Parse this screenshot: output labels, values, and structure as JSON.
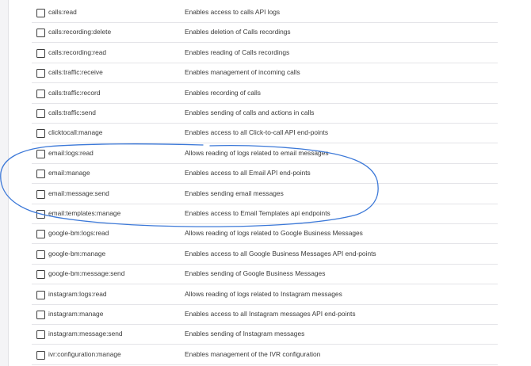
{
  "permissions": [
    {
      "scope": "calls:read",
      "description": "Enables access to calls API logs",
      "checked": false
    },
    {
      "scope": "calls:recording:delete",
      "description": "Enables deletion of Calls recordings",
      "checked": false
    },
    {
      "scope": "calls:recording:read",
      "description": "Enables reading of Calls recordings",
      "checked": false
    },
    {
      "scope": "calls:traffic:receive",
      "description": "Enables management of incoming calls",
      "checked": false
    },
    {
      "scope": "calls:traffic:record",
      "description": "Enables recording of calls",
      "checked": false
    },
    {
      "scope": "calls:traffic:send",
      "description": "Enables sending of calls and actions in calls",
      "checked": false
    },
    {
      "scope": "clicktocall:manage",
      "description": "Enables access to all Click-to-call API end-points",
      "checked": false
    },
    {
      "scope": "email:logs:read",
      "description": "Allows reading of logs related to email messages",
      "checked": false
    },
    {
      "scope": "email:manage",
      "description": "Enables access to all Email API end-points",
      "checked": false
    },
    {
      "scope": "email:message:send",
      "description": "Enables sending email messages",
      "checked": false
    },
    {
      "scope": "email:templates:manage",
      "description": "Enables access to Email Templates api endpoints",
      "checked": false
    },
    {
      "scope": "google-bm:logs:read",
      "description": "Allows reading of logs related to Google Business Messages",
      "checked": false
    },
    {
      "scope": "google-bm:manage",
      "description": "Enables access to all Google Business Messages API end-points",
      "checked": false
    },
    {
      "scope": "google-bm:message:send",
      "description": "Enables sending of Google Business Messages",
      "checked": false
    },
    {
      "scope": "instagram:logs:read",
      "description": "Allows reading of logs related to Instagram messages",
      "checked": false
    },
    {
      "scope": "instagram:manage",
      "description": "Enables access to all Instagram messages API end-points",
      "checked": false
    },
    {
      "scope": "instagram:message:send",
      "description": "Enables sending of Instagram messages",
      "checked": false
    },
    {
      "scope": "ivr:configuration:manage",
      "description": "Enables management of the IVR configuration",
      "checked": false
    }
  ],
  "annotation": {
    "shape": "hand-drawn ellipse",
    "color": "#3b78d8",
    "highlighted_scopes": [
      "email:logs:read",
      "email:manage",
      "email:message:send",
      "email:templates:manage"
    ]
  }
}
